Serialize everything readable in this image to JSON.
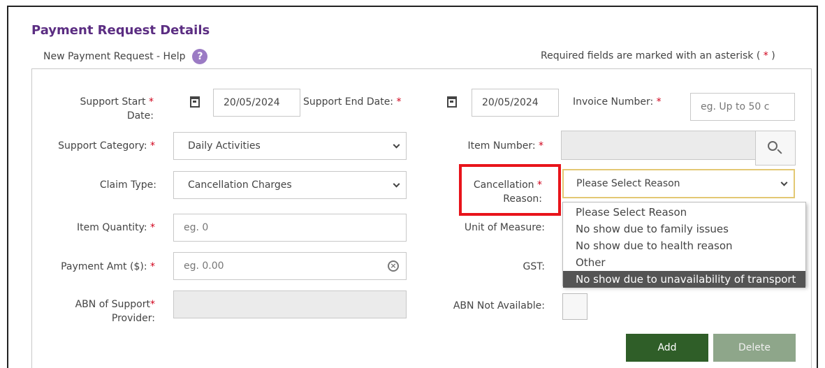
{
  "header": {
    "title": "Payment Request Details",
    "help_text": "New Payment Request - Help",
    "help_icon": "?",
    "required_note": "Required fields are marked with an asterisk (",
    "required_star": "*",
    "required_close": ")"
  },
  "form": {
    "support_start": {
      "label": "Support Start",
      "label2": "Date:",
      "value": "20/05/2024"
    },
    "support_end": {
      "label": "Support End Date:",
      "value": "20/05/2024"
    },
    "invoice": {
      "label": "Invoice Number:",
      "placeholder": "eg. Up to 50 c"
    },
    "support_category": {
      "label": "Support Category:",
      "value": "Daily Activities"
    },
    "item_number": {
      "label": "Item Number:",
      "value": ""
    },
    "claim_type": {
      "label": "Claim Type:",
      "value": "Cancellation Charges"
    },
    "cancellation_reason": {
      "label": "Cancellation",
      "label2": "Reason:",
      "value": "Please Select Reason",
      "options": [
        "Please Select Reason",
        "No show due to family issues",
        "No show due to health reason",
        "Other",
        "No show due to unavailability of transport"
      ],
      "highlighted_option_index": 4
    },
    "item_quantity": {
      "label": "Item Quantity:",
      "placeholder": "eg. 0"
    },
    "unit_of_measure": {
      "label": "Unit of Measure:"
    },
    "payment_amt": {
      "label": "Payment Amt ($):",
      "placeholder": "eg. 0.00"
    },
    "gst": {
      "label": "GST:"
    },
    "abn_provider": {
      "label": "ABN of Support",
      "label2": "Provider:",
      "value": ""
    },
    "abn_not_available": {
      "label": "ABN Not Available:"
    },
    "star": "*"
  },
  "actions": {
    "add_label": "Add",
    "delete_label": "Delete"
  },
  "colors": {
    "title": "#5b2d82",
    "required_star": "#d0021b",
    "highlight": "#e8141b",
    "add_button": "#2f5e28",
    "delete_button": "#8ea68a"
  },
  "icons": {
    "calendar": "calendar-icon",
    "search": "search-icon",
    "clear": "clear-icon",
    "help": "help-icon",
    "chevron": "chevron-down-icon"
  }
}
